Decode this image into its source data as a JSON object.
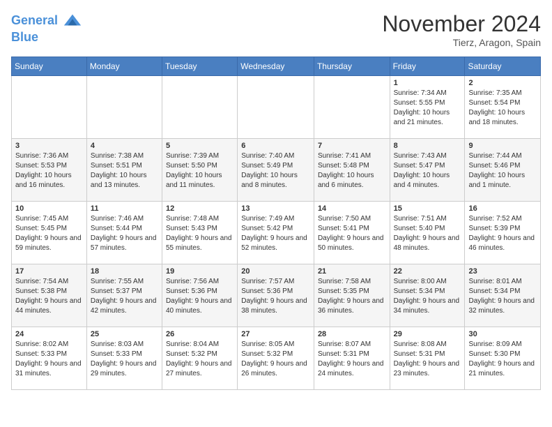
{
  "header": {
    "logo_line1": "General",
    "logo_line2": "Blue",
    "month_title": "November 2024",
    "location": "Tierz, Aragon, Spain"
  },
  "weekdays": [
    "Sunday",
    "Monday",
    "Tuesday",
    "Wednesday",
    "Thursday",
    "Friday",
    "Saturday"
  ],
  "weeks": [
    [
      {
        "day": "",
        "info": ""
      },
      {
        "day": "",
        "info": ""
      },
      {
        "day": "",
        "info": ""
      },
      {
        "day": "",
        "info": ""
      },
      {
        "day": "",
        "info": ""
      },
      {
        "day": "1",
        "info": "Sunrise: 7:34 AM\nSunset: 5:55 PM\nDaylight: 10 hours and 21 minutes."
      },
      {
        "day": "2",
        "info": "Sunrise: 7:35 AM\nSunset: 5:54 PM\nDaylight: 10 hours and 18 minutes."
      }
    ],
    [
      {
        "day": "3",
        "info": "Sunrise: 7:36 AM\nSunset: 5:53 PM\nDaylight: 10 hours and 16 minutes."
      },
      {
        "day": "4",
        "info": "Sunrise: 7:38 AM\nSunset: 5:51 PM\nDaylight: 10 hours and 13 minutes."
      },
      {
        "day": "5",
        "info": "Sunrise: 7:39 AM\nSunset: 5:50 PM\nDaylight: 10 hours and 11 minutes."
      },
      {
        "day": "6",
        "info": "Sunrise: 7:40 AM\nSunset: 5:49 PM\nDaylight: 10 hours and 8 minutes."
      },
      {
        "day": "7",
        "info": "Sunrise: 7:41 AM\nSunset: 5:48 PM\nDaylight: 10 hours and 6 minutes."
      },
      {
        "day": "8",
        "info": "Sunrise: 7:43 AM\nSunset: 5:47 PM\nDaylight: 10 hours and 4 minutes."
      },
      {
        "day": "9",
        "info": "Sunrise: 7:44 AM\nSunset: 5:46 PM\nDaylight: 10 hours and 1 minute."
      }
    ],
    [
      {
        "day": "10",
        "info": "Sunrise: 7:45 AM\nSunset: 5:45 PM\nDaylight: 9 hours and 59 minutes."
      },
      {
        "day": "11",
        "info": "Sunrise: 7:46 AM\nSunset: 5:44 PM\nDaylight: 9 hours and 57 minutes."
      },
      {
        "day": "12",
        "info": "Sunrise: 7:48 AM\nSunset: 5:43 PM\nDaylight: 9 hours and 55 minutes."
      },
      {
        "day": "13",
        "info": "Sunrise: 7:49 AM\nSunset: 5:42 PM\nDaylight: 9 hours and 52 minutes."
      },
      {
        "day": "14",
        "info": "Sunrise: 7:50 AM\nSunset: 5:41 PM\nDaylight: 9 hours and 50 minutes."
      },
      {
        "day": "15",
        "info": "Sunrise: 7:51 AM\nSunset: 5:40 PM\nDaylight: 9 hours and 48 minutes."
      },
      {
        "day": "16",
        "info": "Sunrise: 7:52 AM\nSunset: 5:39 PM\nDaylight: 9 hours and 46 minutes."
      }
    ],
    [
      {
        "day": "17",
        "info": "Sunrise: 7:54 AM\nSunset: 5:38 PM\nDaylight: 9 hours and 44 minutes."
      },
      {
        "day": "18",
        "info": "Sunrise: 7:55 AM\nSunset: 5:37 PM\nDaylight: 9 hours and 42 minutes."
      },
      {
        "day": "19",
        "info": "Sunrise: 7:56 AM\nSunset: 5:36 PM\nDaylight: 9 hours and 40 minutes."
      },
      {
        "day": "20",
        "info": "Sunrise: 7:57 AM\nSunset: 5:36 PM\nDaylight: 9 hours and 38 minutes."
      },
      {
        "day": "21",
        "info": "Sunrise: 7:58 AM\nSunset: 5:35 PM\nDaylight: 9 hours and 36 minutes."
      },
      {
        "day": "22",
        "info": "Sunrise: 8:00 AM\nSunset: 5:34 PM\nDaylight: 9 hours and 34 minutes."
      },
      {
        "day": "23",
        "info": "Sunrise: 8:01 AM\nSunset: 5:34 PM\nDaylight: 9 hours and 32 minutes."
      }
    ],
    [
      {
        "day": "24",
        "info": "Sunrise: 8:02 AM\nSunset: 5:33 PM\nDaylight: 9 hours and 31 minutes."
      },
      {
        "day": "25",
        "info": "Sunrise: 8:03 AM\nSunset: 5:33 PM\nDaylight: 9 hours and 29 minutes."
      },
      {
        "day": "26",
        "info": "Sunrise: 8:04 AM\nSunset: 5:32 PM\nDaylight: 9 hours and 27 minutes."
      },
      {
        "day": "27",
        "info": "Sunrise: 8:05 AM\nSunset: 5:32 PM\nDaylight: 9 hours and 26 minutes."
      },
      {
        "day": "28",
        "info": "Sunrise: 8:07 AM\nSunset: 5:31 PM\nDaylight: 9 hours and 24 minutes."
      },
      {
        "day": "29",
        "info": "Sunrise: 8:08 AM\nSunset: 5:31 PM\nDaylight: 9 hours and 23 minutes."
      },
      {
        "day": "30",
        "info": "Sunrise: 8:09 AM\nSunset: 5:30 PM\nDaylight: 9 hours and 21 minutes."
      }
    ]
  ]
}
